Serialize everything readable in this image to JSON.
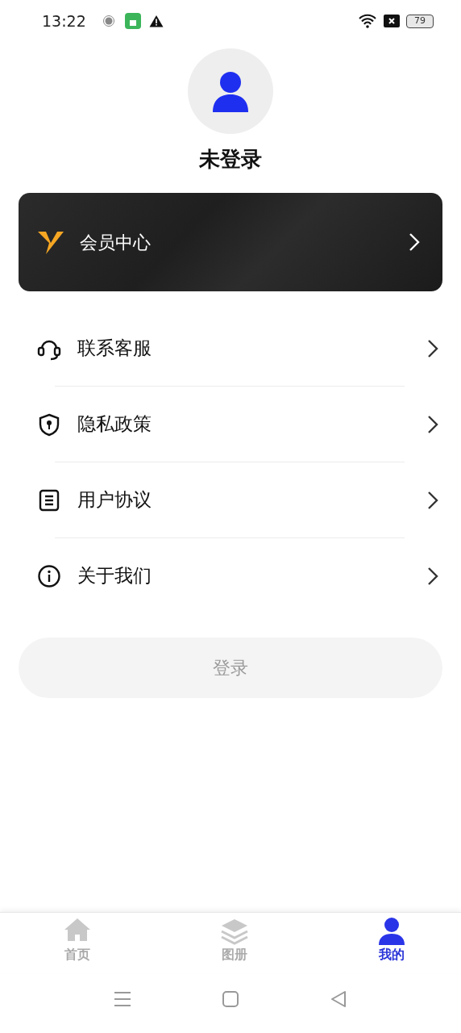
{
  "status_bar": {
    "time": "13:22",
    "battery": "79"
  },
  "profile": {
    "name": "未登录"
  },
  "member_card": {
    "label": "会员中心"
  },
  "menu": [
    {
      "kind": "support",
      "label": "联系客服"
    },
    {
      "kind": "privacy",
      "label": "隐私政策"
    },
    {
      "kind": "agreement",
      "label": "用户协议"
    },
    {
      "kind": "about",
      "label": "关于我们"
    }
  ],
  "login_button": {
    "label": "登录"
  },
  "tabs": [
    {
      "kind": "home",
      "label": "首页",
      "selected": false
    },
    {
      "kind": "album",
      "label": "图册",
      "selected": false
    },
    {
      "kind": "mine",
      "label": "我的",
      "selected": true
    }
  ]
}
